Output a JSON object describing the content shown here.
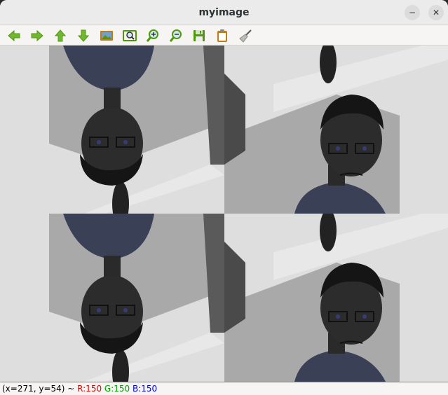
{
  "window": {
    "title": "myimage",
    "minimize_icon": "minimize-icon",
    "close_icon": "close-icon"
  },
  "toolbar": {
    "items": [
      {
        "name": "pan-left-button",
        "icon": "arrow-left-icon",
        "color": "#4e9a06"
      },
      {
        "name": "pan-right-button",
        "icon": "arrow-right-icon",
        "color": "#4e9a06"
      },
      {
        "name": "pan-up-button",
        "icon": "arrow-up-icon",
        "color": "#4e9a06"
      },
      {
        "name": "pan-down-button",
        "icon": "arrow-down-icon",
        "color": "#4e9a06"
      },
      {
        "name": "zoom-image-button",
        "icon": "image-icon",
        "color": "#c17d11"
      },
      {
        "name": "zoom-fit-button",
        "icon": "zoom-fit-icon",
        "color": "#4e9a06"
      },
      {
        "name": "zoom-in-button",
        "icon": "zoom-in-icon",
        "color": "#4e9a06"
      },
      {
        "name": "zoom-out-button",
        "icon": "zoom-out-icon",
        "color": "#4e9a06"
      },
      {
        "name": "save-button",
        "icon": "save-icon",
        "color": "#4e9a06"
      },
      {
        "name": "properties-button",
        "icon": "clipboard-icon",
        "color": "#c17d11"
      },
      {
        "name": "clear-button",
        "icon": "broom-icon",
        "color": "#888a85"
      }
    ]
  },
  "status": {
    "coords": "(x=271, y=54) ~ ",
    "r": "R:150",
    "g": "G:150",
    "b": "B:150"
  }
}
